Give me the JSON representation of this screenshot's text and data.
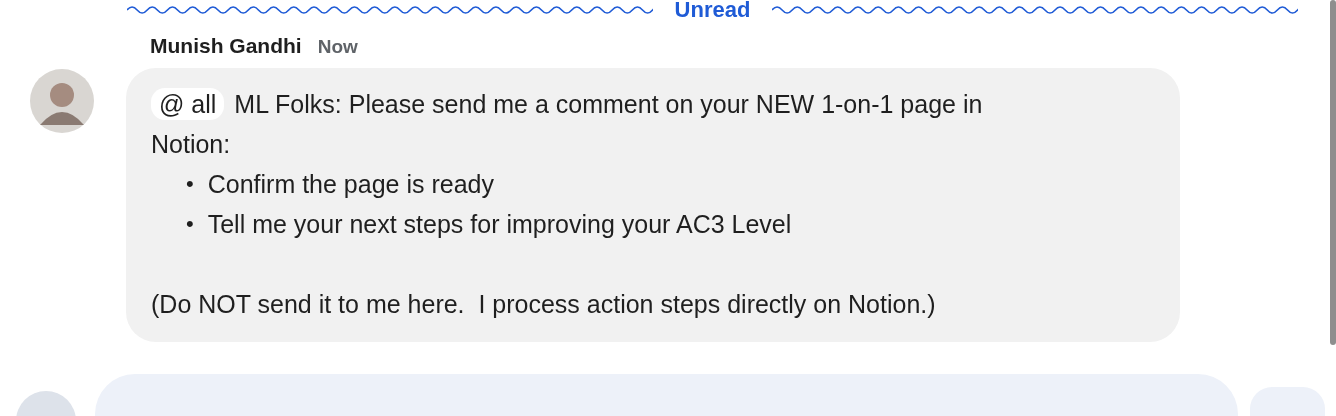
{
  "divider": {
    "label": "Unread"
  },
  "message": {
    "sender": "Munish Gandhi",
    "time": "Now",
    "mention": "@ all",
    "intro": "ML Folks: Please send me a comment on your NEW 1-on-1 page in Notion:",
    "bullets": [
      {
        "marker": "•",
        "text": "Confirm the page is ready"
      },
      {
        "marker": "•",
        "text": "Tell me your next steps for improving your AC3 Level"
      }
    ],
    "footer": "(Do NOT send it to me here.  I process action steps directly on Notion.)"
  }
}
